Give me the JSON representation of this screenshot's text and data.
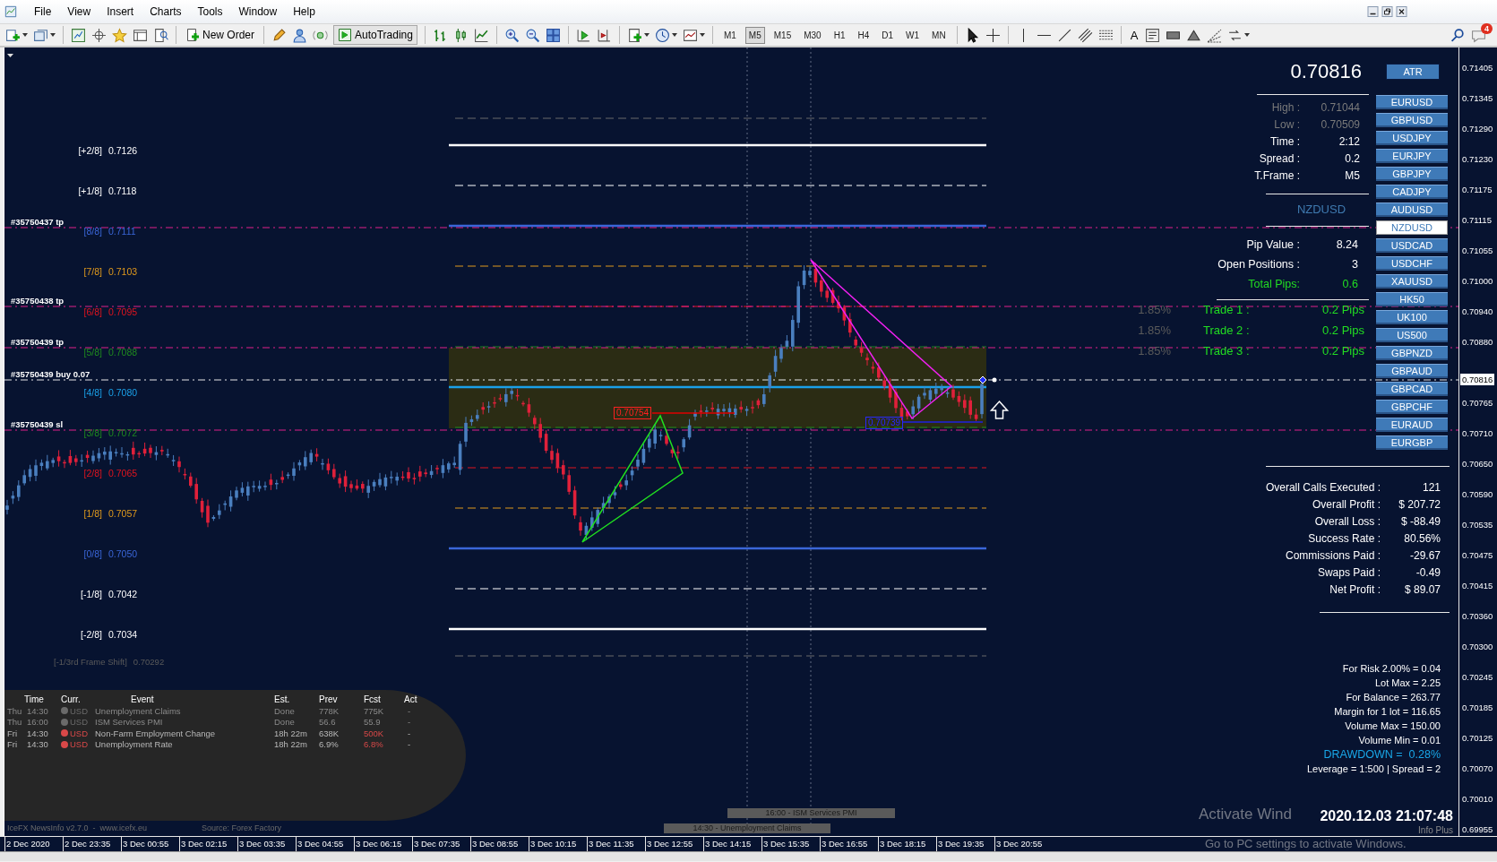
{
  "menu": [
    "File",
    "View",
    "Insert",
    "Charts",
    "Tools",
    "Window",
    "Help"
  ],
  "toolbar": {
    "new_order": "New Order",
    "autotrading": "AutoTrading",
    "text_tool": "A",
    "notifications": "4",
    "timeframes": [
      {
        "label": "M1",
        "selected": false
      },
      {
        "label": "M5",
        "selected": true
      },
      {
        "label": "M15",
        "selected": false
      },
      {
        "label": "M30",
        "selected": false
      },
      {
        "label": "H1",
        "selected": false
      },
      {
        "label": "H4",
        "selected": false
      },
      {
        "label": "D1",
        "selected": false
      },
      {
        "label": "W1",
        "selected": false
      },
      {
        "label": "MN",
        "selected": false
      }
    ]
  },
  "chart": {
    "levels": [
      {
        "tag": "[+2/8]",
        "value": "0.7126",
        "color": "#ffffff",
        "kind": "major"
      },
      {
        "tag": "[+1/8]",
        "value": "0.7118",
        "color": "#ffffff",
        "kind": "minor"
      },
      {
        "tag": "[8/8]",
        "value": "0.7111",
        "color": "#3a66d8",
        "kind": "major"
      },
      {
        "tag": "[7/8]",
        "value": "0.7103",
        "color": "#e09a1c",
        "kind": "minor"
      },
      {
        "tag": "[6/8]",
        "value": "0.7095",
        "color": "#e0141e",
        "kind": "minor"
      },
      {
        "tag": "[5/8]",
        "value": "0.7088",
        "color": "#1f8a1f",
        "kind": "minor"
      },
      {
        "tag": "[4/8]",
        "value": "0.7080",
        "color": "#1aa0e8",
        "kind": "major"
      },
      {
        "tag": "[3/8]",
        "value": "0.7072",
        "color": "#1f8a1f",
        "kind": "minor"
      },
      {
        "tag": "[2/8]",
        "value": "0.7065",
        "color": "#e0141e",
        "kind": "minor"
      },
      {
        "tag": "[1/8]",
        "value": "0.7057",
        "color": "#e09a1c",
        "kind": "minor"
      },
      {
        "tag": "[0/8]",
        "value": "0.7050",
        "color": "#3a66d8",
        "kind": "major"
      },
      {
        "tag": "[-1/8]",
        "value": "0.7042",
        "color": "#ffffff",
        "kind": "minor"
      },
      {
        "tag": "[-2/8]",
        "value": "0.7034",
        "color": "#ffffff",
        "kind": "major"
      }
    ],
    "frame_shift": {
      "label": "[-1/3rd Frame Shift]",
      "value": "0.70292"
    },
    "order_lines": [
      {
        "label": "#35750437 tp",
        "kind": "tp"
      },
      {
        "label": "#35750438 tp",
        "kind": "tp"
      },
      {
        "label": "#35750439 tp",
        "kind": "tp"
      },
      {
        "label": "#35750439 buy 0.07",
        "kind": "entry"
      },
      {
        "label": "#35750439 sl",
        "kind": "sl"
      }
    ],
    "price_markers": [
      "0.70754",
      "0.70739"
    ],
    "news_markers": [
      "16:00 - ISM Services PMI",
      "14:30 - Unemployment Claims"
    ]
  },
  "info_panel": {
    "price": "0.70816",
    "stats": [
      {
        "label": "High :",
        "value": "0.71044",
        "dim": true
      },
      {
        "label": "Low :",
        "value": "0.70509",
        "dim": true
      },
      {
        "label": "Time :",
        "value": "2:12",
        "dim": false
      },
      {
        "label": "Spread :",
        "value": "0.2",
        "dim": false
      },
      {
        "label": "T.Frame :",
        "value": "M5",
        "dim": false
      }
    ],
    "symbol": "NZDUSD",
    "pip_rows": [
      {
        "label": "Pip Value :",
        "value": "8.24",
        "kind": "plain"
      },
      {
        "label": "Open Positions :",
        "value": "3",
        "kind": "plain"
      },
      {
        "label": "Total Pips:",
        "value": "0.6",
        "kind": "total"
      }
    ],
    "trades": [
      {
        "percent": "1.85%",
        "label": "Trade 1 :",
        "pips": "0.2 Pips"
      },
      {
        "percent": "1.85%",
        "label": "Trade 2 :",
        "pips": "0.2 Pips"
      },
      {
        "percent": "1.85%",
        "label": "Trade 3 :",
        "pips": "0.2 Pips"
      }
    ]
  },
  "symbol_buttons": {
    "atr": "ATR",
    "symbols": [
      {
        "label": "EURUSD",
        "selected": false
      },
      {
        "label": "GBPUSD",
        "selected": false
      },
      {
        "label": "USDJPY",
        "selected": false
      },
      {
        "label": "EURJPY",
        "selected": false
      },
      {
        "label": "GBPJPY",
        "selected": false
      },
      {
        "label": "CADJPY",
        "selected": false
      },
      {
        "label": "AUDUSD",
        "selected": false
      },
      {
        "label": "NZDUSD",
        "selected": true
      },
      {
        "label": "USDCAD",
        "selected": false
      },
      {
        "label": "USDCHF",
        "selected": false
      },
      {
        "label": "XAUUSD",
        "selected": false
      },
      {
        "label": "HK50",
        "selected": false
      },
      {
        "label": "UK100",
        "selected": false
      },
      {
        "label": "US500",
        "selected": false
      },
      {
        "label": "GBPNZD",
        "selected": false
      },
      {
        "label": "GBPAUD",
        "selected": false
      },
      {
        "label": "GBPCAD",
        "selected": false
      },
      {
        "label": "GBPCHF",
        "selected": false
      },
      {
        "label": "EURAUD",
        "selected": false
      },
      {
        "label": "EURGBP",
        "selected": false
      }
    ]
  },
  "account": {
    "stats": [
      {
        "label": "Overall Calls Executed :",
        "value": "121"
      },
      {
        "label": "Overall Profit :",
        "value": "$ 207.72"
      },
      {
        "label": "Overall Loss :",
        "value": "$ -88.49"
      },
      {
        "label": "Success Rate :",
        "value": "80.56%"
      },
      {
        "label": "Commissions Paid :",
        "value": "-29.67"
      },
      {
        "label": "Swaps Paid :",
        "value": "-0.49"
      },
      {
        "label": "Net Profit :",
        "value": "$ 89.07"
      }
    ],
    "risk": [
      {
        "text": "For Risk 2.00% = 0.04",
        "kind": "plain"
      },
      {
        "text": "Lot Max = 2.25",
        "kind": "plain"
      },
      {
        "text": "For Balance = 263.77",
        "kind": "plain"
      },
      {
        "text": "Margin for 1 lot = 116.65",
        "kind": "plain"
      },
      {
        "text": "Volume Max = 150.00",
        "kind": "plain"
      },
      {
        "text": "Volume Min = 0.01",
        "kind": "plain"
      },
      {
        "text": "DRAWDOWN =  0.28%",
        "kind": "alert"
      },
      {
        "text": "Leverage = 1:500 | Spread = 2",
        "kind": "plain"
      }
    ],
    "datetime": "2020.12.03 21:07:48",
    "caption": "Info Plus"
  },
  "news": {
    "columns": [
      "Time",
      "Curr.",
      "Event",
      "Est.",
      "Prev",
      "Fcst",
      "Act"
    ],
    "rows": [
      {
        "day": "Thu",
        "time": "14:30",
        "currency": "USD",
        "event": "Unemployment Claims",
        "est": "Done",
        "prev": "778K",
        "fcst": "775K",
        "act": "-",
        "color": "#6a6a6a",
        "past": true
      },
      {
        "day": "Thu",
        "time": "16:00",
        "currency": "USD",
        "event": "ISM Services PMI",
        "est": "Done",
        "prev": "56.6",
        "fcst": "55.9",
        "act": "-",
        "color": "#6a6a6a",
        "past": true
      },
      {
        "day": "Fri",
        "time": "14:30",
        "currency": "USD",
        "event": "Non-Farm Employment Change",
        "est": "18h 22m",
        "prev": "638K",
        "fcst": "500K",
        "act": "-",
        "color": "#d84848",
        "past": false
      },
      {
        "day": "Fri",
        "time": "14:30",
        "currency": "USD",
        "event": "Unemployment Rate",
        "est": "18h 22m",
        "prev": "6.9%",
        "fcst": "6.8%",
        "act": "-",
        "color": "#d84848",
        "past": false
      }
    ],
    "footer": "IceFX NewsInfo v2.7.0  -  www.icefx.eu",
    "source": "Source: Forex Factory"
  },
  "price_axis": {
    "ticks": [
      "0.71405",
      "0.71345",
      "0.71290",
      "0.71230",
      "0.71175",
      "0.71115",
      "0.71055",
      "0.71000",
      "0.70940",
      "0.70880",
      "0.70765",
      "0.70710",
      "0.70650",
      "0.70590",
      "0.70535",
      "0.70475",
      "0.70415",
      "0.70360",
      "0.70300",
      "0.70245",
      "0.70185",
      "0.70125",
      "0.70070",
      "0.70010",
      "0.69955"
    ],
    "current": "0.70816"
  },
  "time_axis": [
    "2 Dec 2020",
    "2 Dec 23:35",
    "3 Dec 00:55",
    "3 Dec 02:15",
    "3 Dec 03:35",
    "3 Dec 04:55",
    "3 Dec 06:15",
    "3 Dec 07:35",
    "3 Dec 08:55",
    "3 Dec 10:15",
    "3 Dec 11:35",
    "3 Dec 12:55",
    "3 Dec 14:15",
    "3 Dec 15:35",
    "3 Dec 16:55",
    "3 Dec 18:15",
    "3 Dec 19:35",
    "3 Dec 20:55"
  ],
  "os_notice": {
    "title": "Activate Wind",
    "text": "Go to PC settings to activate Windows."
  }
}
